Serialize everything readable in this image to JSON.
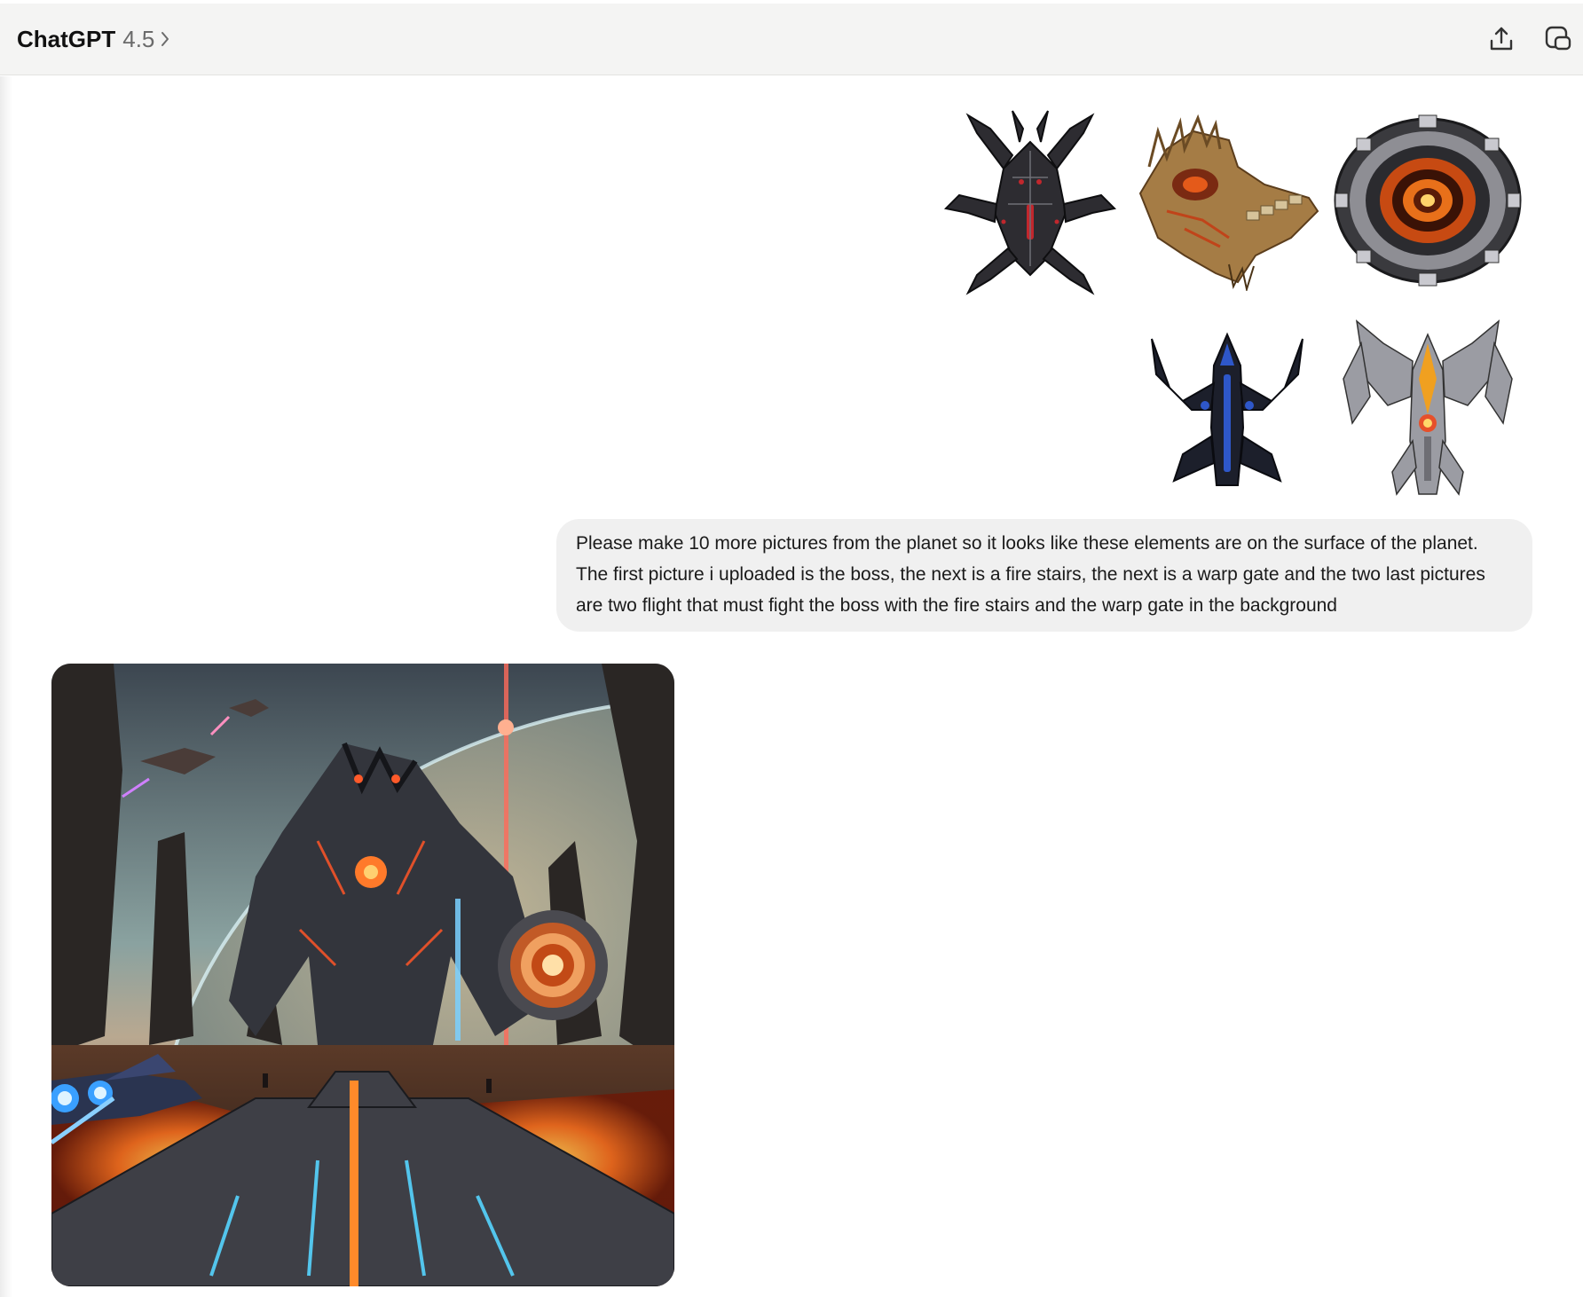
{
  "header": {
    "app_name": "ChatGPT",
    "model": "4.5",
    "icons": [
      "share-icon",
      "new-window-icon"
    ]
  },
  "conversation": {
    "uploaded_images": [
      {
        "name": "boss"
      },
      {
        "name": "fire-stairs"
      },
      {
        "name": "warp-gate"
      },
      {
        "name": "flight-1"
      },
      {
        "name": "flight-2"
      }
    ],
    "user_message": "Please make 10 more pictures from the planet so it looks like these elements are on the surface of the planet. The first picture i uploaded is the boss, the next is a fire stairs, the next is a warp gate and the two last pictures are two flight that must fight the boss with the fire stairs and the warp gate in the background",
    "assistant_image": {
      "name": "generated-battle-scene"
    }
  },
  "colors": {
    "topbar": "#f4f4f3",
    "bubble": "#f0f0f0",
    "text": "#1a1a1a",
    "muted": "#6b6b6b"
  }
}
